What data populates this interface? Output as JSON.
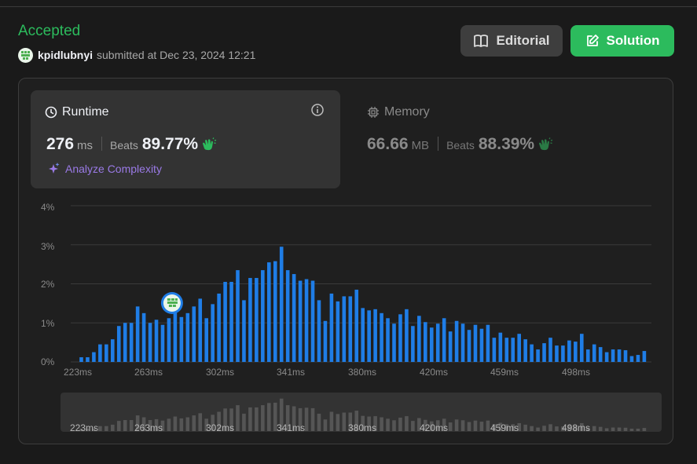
{
  "submission": {
    "status": "Accepted",
    "username": "kpidlubnyi",
    "submitted_text": "submitted at Dec 23, 2024 12:21"
  },
  "buttons": {
    "editorial": "Editorial",
    "solution": "Solution"
  },
  "runtime": {
    "title": "Runtime",
    "value": "276",
    "unit": "ms",
    "beats_label": "Beats",
    "beats_value": "89.77%",
    "analyze_label": "Analyze Complexity"
  },
  "memory": {
    "title": "Memory",
    "value": "66.66",
    "unit": "MB",
    "beats_label": "Beats",
    "beats_value": "88.39%"
  },
  "colors": {
    "accepted": "#2cbb5d",
    "bar": "#1f7de6",
    "analyze": "#9a7ae6"
  },
  "chart_data": {
    "type": "bar",
    "x_tick_labels": [
      "223ms",
      "263ms",
      "302ms",
      "341ms",
      "380ms",
      "420ms",
      "459ms",
      "498ms"
    ],
    "y_tick_labels": [
      "4%",
      "3%",
      "2%",
      "1%",
      "0%"
    ],
    "ylim": [
      0,
      4
    ],
    "grid": true,
    "values": [
      0.12,
      0.12,
      0.25,
      0.45,
      0.45,
      0.58,
      0.92,
      1.0,
      1.0,
      1.42,
      1.25,
      1.0,
      1.08,
      0.95,
      1.12,
      1.32,
      1.15,
      1.25,
      1.42,
      1.62,
      1.12,
      1.48,
      1.75,
      2.05,
      2.05,
      2.35,
      1.58,
      2.15,
      2.15,
      2.35,
      2.55,
      2.58,
      2.95,
      2.35,
      2.25,
      2.08,
      2.12,
      2.08,
      1.58,
      1.05,
      1.75,
      1.55,
      1.68,
      1.68,
      1.85,
      1.38,
      1.32,
      1.35,
      1.25,
      1.12,
      0.98,
      1.22,
      1.35,
      0.92,
      1.18,
      1.02,
      0.88,
      0.98,
      1.12,
      0.78,
      1.05,
      0.98,
      0.82,
      0.95,
      0.85,
      0.95,
      0.62,
      0.75,
      0.62,
      0.62,
      0.72,
      0.58,
      0.45,
      0.32,
      0.48,
      0.62,
      0.42,
      0.42,
      0.55,
      0.52,
      0.72,
      0.32,
      0.45,
      0.38,
      0.25,
      0.32,
      0.32,
      0.3,
      0.15,
      0.18,
      0.28
    ],
    "highlighted_value": "276ms"
  }
}
